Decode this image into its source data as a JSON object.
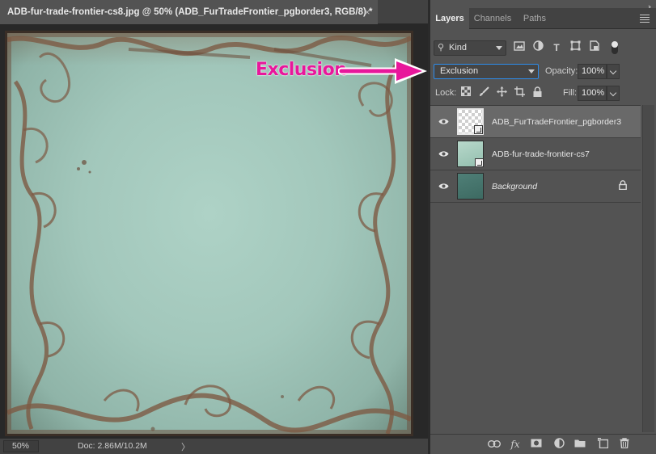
{
  "document": {
    "tab_title": "ADB-fur-trade-frontier-cs8.jpg @ 50% (ADB_FurTradeFrontier_pgborder3, RGB/8) *",
    "close_glyph": "×"
  },
  "status": {
    "zoom": "50%",
    "doc_size": "Doc: 2.86M/10.2M",
    "arrow": "〉"
  },
  "annotation": {
    "text": "Exclusion",
    "color": "#e8179b"
  },
  "panel": {
    "tabs": [
      {
        "label": "Layers",
        "active": true
      },
      {
        "label": "Channels",
        "active": false
      },
      {
        "label": "Paths",
        "active": false
      }
    ],
    "filter": {
      "kind_label": "Kind",
      "icons": [
        "image-filter-icon",
        "adjustment-filter-icon",
        "type-filter-icon",
        "shape-filter-icon",
        "smart-object-filter-icon"
      ]
    },
    "blend": {
      "mode": "Exclusion",
      "opacity_label": "Opacity:",
      "opacity_value": "100%"
    },
    "lock": {
      "label": "Lock:",
      "fill_label": "Fill:",
      "fill_value": "100%"
    },
    "layers": [
      {
        "name": "ADB_FurTradeFrontier_pgborder3",
        "selected": true,
        "smart_object": true,
        "italic": false,
        "locked": false
      },
      {
        "name": "ADB-fur-trade-frontier-cs7",
        "selected": false,
        "smart_object": true,
        "italic": false,
        "locked": false
      },
      {
        "name": "Background",
        "selected": false,
        "smart_object": false,
        "italic": true,
        "locked": true
      }
    ]
  },
  "colors": {
    "panel_bg": "#535353",
    "selected_layer": "#696969",
    "accent_focus": "#2d8ceb",
    "paper_mint": "#a8cdc1",
    "border_brown": "#7a5a44"
  }
}
